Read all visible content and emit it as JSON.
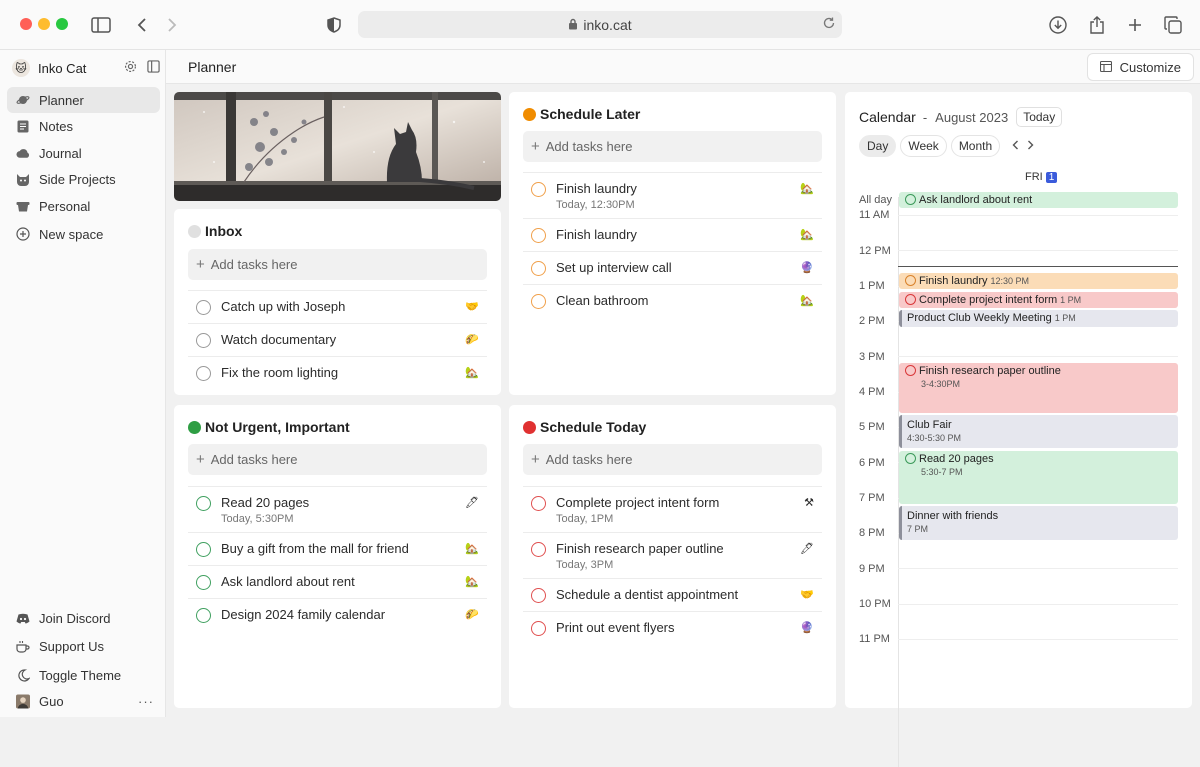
{
  "browser": {
    "url": "inko.cat",
    "colors": {
      "close": "#ff5f57",
      "minimize": "#febc2e",
      "zoom": "#28c840"
    }
  },
  "sidebar": {
    "workspace": "Inko Cat",
    "items": [
      {
        "label": "Planner",
        "icon": "planet-icon",
        "active": true
      },
      {
        "label": "Notes",
        "icon": "notes-icon"
      },
      {
        "label": "Journal",
        "icon": "cloud-icon"
      },
      {
        "label": "Side Projects",
        "icon": "cat-icon"
      },
      {
        "label": "Personal",
        "icon": "cup-icon"
      },
      {
        "label": "New space",
        "icon": "plus-circle-icon"
      }
    ],
    "bottom": [
      {
        "label": "Join Discord",
        "icon": "discord-icon"
      },
      {
        "label": "Support Us",
        "icon": "coffee-icon"
      },
      {
        "label": "Toggle Theme",
        "icon": "moon-icon"
      }
    ],
    "user": {
      "name": "Guo",
      "more": "···"
    }
  },
  "header": {
    "title": "Planner",
    "customize_label": "Customize"
  },
  "add_placeholder": "Add tasks here",
  "lists": {
    "inbox": {
      "title": "Inbox",
      "color": "#dddddd",
      "tasks": [
        {
          "name": "Catch up with Joseph",
          "emoji": "🤝"
        },
        {
          "name": "Watch documentary",
          "emoji": "🌮"
        },
        {
          "name": "Fix the room lighting",
          "emoji": "🏡"
        }
      ]
    },
    "schedule_later": {
      "title": "Schedule Later",
      "color": "#f08c00",
      "tasks": [
        {
          "name": "Finish laundry",
          "sub": "Today, 12:30PM",
          "emoji": "🏡"
        },
        {
          "name": "Finish laundry",
          "emoji": "🏡"
        },
        {
          "name": "Set up interview call",
          "emoji": "🔮"
        },
        {
          "name": "Clean bathroom",
          "emoji": "🏡"
        }
      ]
    },
    "not_urgent": {
      "title": "Not Urgent, Important",
      "color": "#2f9e44",
      "tasks": [
        {
          "name": "Read 20 pages",
          "sub": "Today, 5:30PM",
          "emoji": "🖊"
        },
        {
          "name": "Buy a gift from the mall for friend",
          "emoji": "🏡"
        },
        {
          "name": "Ask landlord about rent",
          "emoji": "🏡"
        },
        {
          "name": "Design 2024 family calendar",
          "emoji": "🌮"
        }
      ]
    },
    "schedule_today": {
      "title": "Schedule Today",
      "color": "#e03131",
      "tasks": [
        {
          "name": "Complete project intent form",
          "sub": "Today, 1PM",
          "emoji": "⚒"
        },
        {
          "name": "Finish research paper outline",
          "sub": "Today, 3PM",
          "emoji": "🖊"
        },
        {
          "name": "Schedule a dentist appointment",
          "emoji": "🤝"
        },
        {
          "name": "Print out event flyers",
          "emoji": "🔮"
        }
      ]
    }
  },
  "calendar": {
    "title": "Calendar",
    "separator": "-",
    "month": "August 2023",
    "today_label": "Today",
    "views": [
      "Day",
      "Week",
      "Month"
    ],
    "day_label": "FRI",
    "day_num": "1",
    "all_day_label": "All day",
    "hours": [
      "11 AM",
      "12 PM",
      "1 PM",
      "2 PM",
      "3 PM",
      "4 PM",
      "5 PM",
      "6 PM",
      "7 PM",
      "8 PM",
      "9 PM",
      "10 PM",
      "11 PM"
    ],
    "events": [
      {
        "title": "Ask landlord about rent"
      },
      {
        "title": "Finish laundry",
        "time": "12:30 PM"
      },
      {
        "title": "Complete project intent form",
        "time": "1 PM"
      },
      {
        "title": "Product Club Weekly Meeting",
        "time": "1 PM"
      },
      {
        "title": "Finish research paper outline",
        "time": "3-4:30PM"
      },
      {
        "title": "Club Fair",
        "time": "4:30-5:30 PM"
      },
      {
        "title": "Read 20 pages",
        "time": "5:30-7 PM"
      },
      {
        "title": "Dinner with friends",
        "time": "7 PM"
      }
    ]
  }
}
